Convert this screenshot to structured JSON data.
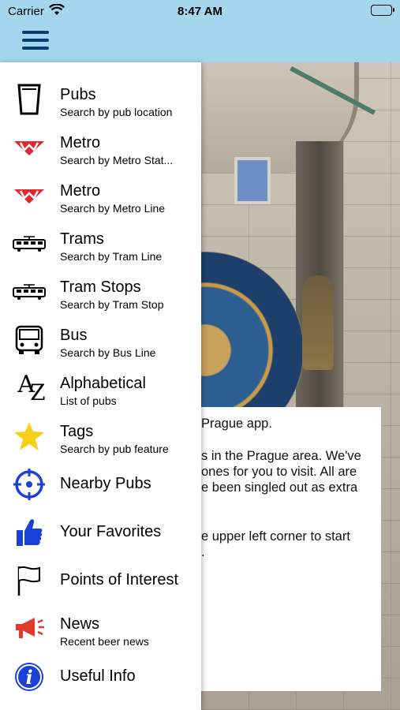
{
  "status_bar": {
    "carrier": "Carrier",
    "time": "8:47 AM"
  },
  "nav": {
    "menu_icon": "hamburger-menu-icon"
  },
  "background": {
    "content_lines": [
      "Prague app.",
      "s in the Prague area. We've",
      "ones for you to visit. All are",
      "e been singled out as extra",
      "e upper left corner to start",
      "."
    ]
  },
  "menu": {
    "items": [
      {
        "title": "Pubs",
        "subtitle": "Search by pub location",
        "icon": "beer-glass-icon"
      },
      {
        "title": "Metro",
        "subtitle": "Search by Metro Stat...",
        "icon": "metro-logo-icon"
      },
      {
        "title": "Metro",
        "subtitle": "Search by Metro Line",
        "icon": "metro-logo-icon"
      },
      {
        "title": "Trams",
        "subtitle": "Search by Tram Line",
        "icon": "tram-icon"
      },
      {
        "title": "Tram Stops",
        "subtitle": "Search by Tram Stop",
        "icon": "tram-icon"
      },
      {
        "title": "Bus",
        "subtitle": "Search by Bus Line",
        "icon": "bus-icon"
      },
      {
        "title": "Alphabetical",
        "subtitle": "List of pubs",
        "icon": "az-icon",
        "icon_text": "AZ"
      },
      {
        "title": "Tags",
        "subtitle": "Search by pub feature",
        "icon": "star-icon"
      },
      {
        "title": "Nearby Pubs",
        "subtitle": "",
        "icon": "crosshair-icon"
      },
      {
        "title": "Your Favorites",
        "subtitle": "",
        "icon": "thumbs-up-icon"
      },
      {
        "title": "Points of Interest",
        "subtitle": "",
        "icon": "flag-icon"
      },
      {
        "title": "News",
        "subtitle": "Recent beer news",
        "icon": "megaphone-icon"
      },
      {
        "title": "Useful Info",
        "subtitle": "",
        "icon": "info-icon"
      }
    ]
  },
  "colors": {
    "nav_bar": "#a4d7ee",
    "hamburger": "#0b3d72",
    "metro_red": "#e3262f",
    "star_yellow": "#f7d117",
    "icon_blue": "#1b3fd9",
    "megaphone_red": "#e03a2f"
  }
}
